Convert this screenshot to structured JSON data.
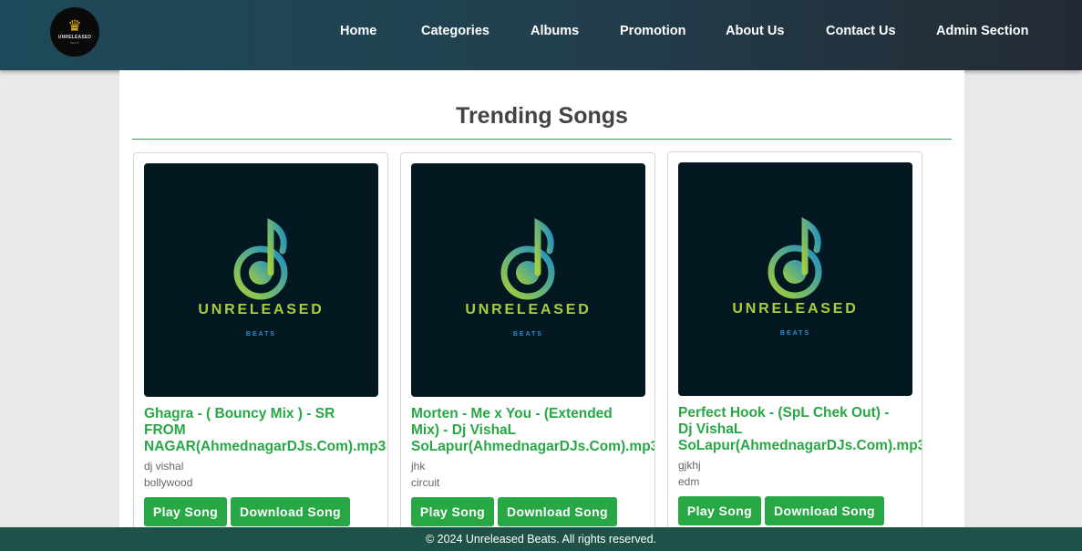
{
  "brand": {
    "logo_text": "UNRELEASED",
    "logo_sub": "BEATS",
    "crown_icon": "crown-icon"
  },
  "nav": {
    "items": [
      {
        "label": "Home"
      },
      {
        "label": "Categories"
      },
      {
        "label": "Albums"
      },
      {
        "label": "Promotion"
      },
      {
        "label": "About Us"
      },
      {
        "label": "Contact Us"
      },
      {
        "label": "Admin Section"
      }
    ]
  },
  "main": {
    "section_title": "Trending Songs"
  },
  "songs": [
    {
      "art_brand": "UNRELEASED",
      "art_sub": "BEATS",
      "title": "Ghagra - ( Bouncy Mix ) - SR\nFROM\nNAGAR(AhmednagarDJs.Com).mp3",
      "artist": "dj vishal",
      "category": "bollywood",
      "play_label": "Play Song",
      "download_label": "Download Song"
    },
    {
      "art_brand": "UNRELEASED",
      "art_sub": "BEATS",
      "title": "Morten - Me x You - (Extended\nMix) - Dj VishaL\nSoLapur(AhmednagarDJs.Com).mp3",
      "artist": "jhk",
      "category": "circuit",
      "play_label": "Play Song",
      "download_label": "Download Song"
    },
    {
      "art_brand": "UNRELEASED",
      "art_sub": "BEATS",
      "title": "Perfect Hook - (SpL Chek Out) -\nDj VishaL\nSoLapur(AhmednagarDJs.Com).mp3",
      "artist": "gjkhj",
      "category": "edm",
      "play_label": "Play Song",
      "download_label": "Download Song"
    }
  ],
  "footer": {
    "text": "© 2024 Unreleased Beats. All rights reserved."
  },
  "colors": {
    "accent_green": "#28a745",
    "nav_dark": "#1d4a5a",
    "footer_bg": "#1e5248",
    "art_bg": "#031820"
  }
}
